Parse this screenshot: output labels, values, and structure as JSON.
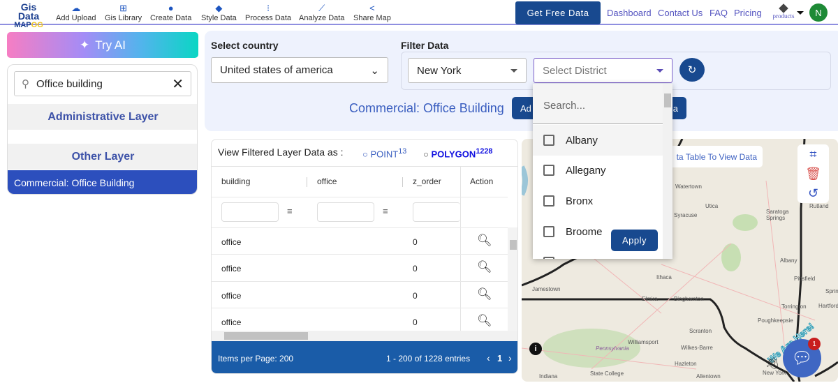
{
  "header": {
    "logo": {
      "line1": "Gis Data",
      "line2a": "MAP",
      "line2b": "OG"
    },
    "nav": [
      {
        "label": "Add Upload",
        "icon": "cloud-upload-icon"
      },
      {
        "label": "Gis Library",
        "icon": "library-add-icon"
      },
      {
        "label": "Create Data",
        "icon": "map-pin-icon"
      },
      {
        "label": "Style Data",
        "icon": "paint-bucket-icon"
      },
      {
        "label": "Process Data",
        "icon": "process-icon"
      },
      {
        "label": "Analyze Data",
        "icon": "analyze-icon"
      },
      {
        "label": "Share Map",
        "icon": "share-icon"
      }
    ],
    "get_free_data": "Get Free Data",
    "links": [
      "Dashboard",
      "Contact Us",
      "FAQ",
      "Pricing"
    ],
    "products": "products",
    "avatar": "N"
  },
  "sidebar": {
    "try_ai": "Try AI",
    "search_value": "Office building",
    "sections": [
      "Administrative Layer",
      "Other Layer"
    ],
    "selected_layer": "Commercial: Office Building"
  },
  "filters": {
    "country_label": "Select country",
    "country_value": "United states of america",
    "filter_label": "Filter Data",
    "state_value": "New York",
    "district_placeholder": "Select District",
    "layer_title": "Commercial: Office Building",
    "add_button_visible": "Ad",
    "second_button_visible": "a"
  },
  "dropdown": {
    "search_placeholder": "Search...",
    "options": [
      "Albany",
      "Allegany",
      "Bronx",
      "Broome"
    ],
    "apply": "Apply"
  },
  "table": {
    "view_label": "View Filtered Layer Data as :",
    "point_label": "POINT",
    "point_count": "13",
    "polygon_label": "POLYGON",
    "polygon_count": "1228",
    "columns": [
      "building",
      "office",
      "z_order",
      "Action"
    ],
    "rows": [
      {
        "building": "office",
        "z_order": "0"
      },
      {
        "building": "office",
        "z_order": "0"
      },
      {
        "building": "office",
        "z_order": "0"
      },
      {
        "building": "office",
        "z_order": "0"
      }
    ],
    "items_per_page": "Items per Page: 200",
    "range": "1 - 200 of 1228 entries",
    "page": "1"
  },
  "map": {
    "hint": "ta Table To View Data",
    "labels": [
      "Ithaca",
      "Jamestown",
      "Elmira",
      "Binghamton",
      "Scranton",
      "Williamsport",
      "Pennsylvania",
      "Wilkes-Barre",
      "Hazleton",
      "State College",
      "Allentown",
      "Indiana",
      "Poughkeepsie",
      "Torrington",
      "Hartford",
      "Pittsfield",
      "Springfield",
      "Albany",
      "Saratoga Springs",
      "Rutland",
      "Utica",
      "Syracuse",
      "Watertown",
      "New York"
    ],
    "chat_badge": "1",
    "we_are_here": "We Are Here!"
  },
  "colors": {
    "primary": "#18498f",
    "selected": "#2c4fbd",
    "footer": "#1a5ca8",
    "avatar": "#1e8a36"
  }
}
